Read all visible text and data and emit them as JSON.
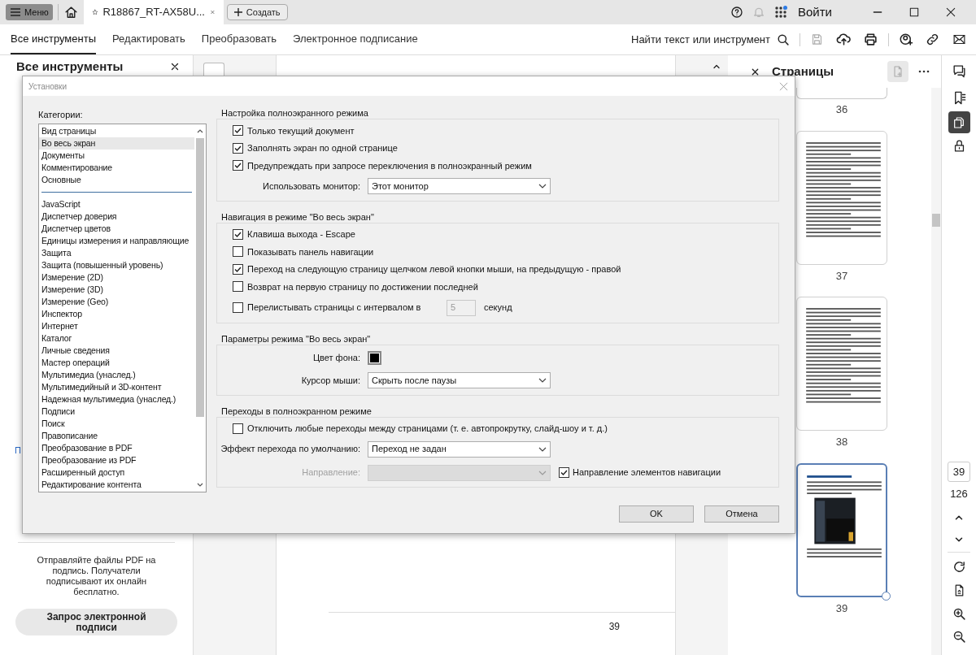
{
  "tabbar": {
    "menu": "Меню",
    "tab_title": "R18867_RT-AX58U...",
    "create": "Создать",
    "sign_in": "Войти"
  },
  "toolbar": {
    "tabs": [
      {
        "label": "Все инструменты",
        "selected": true
      },
      {
        "label": "Редактировать",
        "selected": false
      },
      {
        "label": "Преобразовать",
        "selected": false
      },
      {
        "label": "Электронное подписание",
        "selected": false
      }
    ],
    "search": "Найти текст или инструмент"
  },
  "left_panel": {
    "title": "Все инструменты",
    "cut_link": "П",
    "promo": "Отправляйте файлы PDF на подпись. Получатели подписывают их онлайн бесплатно.",
    "button": "Запрос электронной подписи"
  },
  "document": {
    "page_number": "39"
  },
  "pages_panel": {
    "title": "Страницы",
    "thumbnails": [
      {
        "label": "36",
        "selected": false
      },
      {
        "label": "37",
        "selected": false
      },
      {
        "label": "38",
        "selected": false
      },
      {
        "label": "39",
        "selected": true
      }
    ]
  },
  "page_nav": {
    "current": "39",
    "total": "126"
  },
  "dialog": {
    "title": "Установки",
    "categories_label": "Категории:",
    "categories": [
      {
        "kind": "item",
        "label": "Вид страницы",
        "selected": false
      },
      {
        "kind": "item",
        "label": "Во весь экран",
        "selected": true
      },
      {
        "kind": "item",
        "label": "Документы",
        "selected": false
      },
      {
        "kind": "item",
        "label": "Комментирование",
        "selected": false
      },
      {
        "kind": "item",
        "label": "Основные",
        "selected": false
      },
      {
        "kind": "separator"
      },
      {
        "kind": "item",
        "label": "JavaScript",
        "selected": false
      },
      {
        "kind": "item",
        "label": "Диспетчер доверия",
        "selected": false
      },
      {
        "kind": "item",
        "label": "Диспетчер цветов",
        "selected": false
      },
      {
        "kind": "item",
        "label": "Единицы измерения и направляющие",
        "selected": false
      },
      {
        "kind": "item",
        "label": "Защита",
        "selected": false
      },
      {
        "kind": "item",
        "label": "Защита (повышенный уровень)",
        "selected": false
      },
      {
        "kind": "item",
        "label": "Измерение (2D)",
        "selected": false
      },
      {
        "kind": "item",
        "label": "Измерение (3D)",
        "selected": false
      },
      {
        "kind": "item",
        "label": "Измерение (Geo)",
        "selected": false
      },
      {
        "kind": "item",
        "label": "Инспектор",
        "selected": false
      },
      {
        "kind": "item",
        "label": "Интернет",
        "selected": false
      },
      {
        "kind": "item",
        "label": "Каталог",
        "selected": false
      },
      {
        "kind": "item",
        "label": "Личные сведения",
        "selected": false
      },
      {
        "kind": "item",
        "label": "Мастер операций",
        "selected": false
      },
      {
        "kind": "item",
        "label": "Мультимедиа (унаслед.)",
        "selected": false
      },
      {
        "kind": "item",
        "label": "Мультимедийный и 3D-контент",
        "selected": false
      },
      {
        "kind": "item",
        "label": "Надежная мультимедиа (унаслед.)",
        "selected": false
      },
      {
        "kind": "item",
        "label": "Подписи",
        "selected": false
      },
      {
        "kind": "item",
        "label": "Поиск",
        "selected": false
      },
      {
        "kind": "item",
        "label": "Правописание",
        "selected": false
      },
      {
        "kind": "item",
        "label": "Преобразование в PDF",
        "selected": false
      },
      {
        "kind": "item",
        "label": "Преобразование из PDF",
        "selected": false
      },
      {
        "kind": "item",
        "label": "Расширенный доступ",
        "selected": false
      },
      {
        "kind": "item",
        "label": "Редактирование контента",
        "selected": false
      }
    ],
    "sections": [
      {
        "title": "Настройка полноэкранного режима",
        "rows": [
          {
            "kind": "checkbox",
            "label": "Только текущий документ",
            "checked": true
          },
          {
            "kind": "checkbox",
            "label": "Заполнять экран по одной странице",
            "checked": true
          },
          {
            "kind": "checkbox",
            "label": "Предупреждать при запросе переключения в полноэкранный режим",
            "checked": true
          },
          {
            "kind": "select",
            "label": "Использовать монитор:",
            "value": "Этот монитор",
            "disabled": false
          }
        ]
      },
      {
        "title": "Навигация в режиме \"Во весь экран\"",
        "rows": [
          {
            "kind": "checkbox",
            "label": "Клавиша выхода - Escape",
            "checked": true
          },
          {
            "kind": "checkbox",
            "label": "Показывать панель навигации",
            "checked": false
          },
          {
            "kind": "checkbox",
            "label": "Переход на следующую страницу щелчком левой кнопки мыши, на предыдущую - правой",
            "checked": true
          },
          {
            "kind": "checkbox",
            "label": "Возврат на первую страницу по достижении последней",
            "checked": false
          },
          {
            "kind": "interval",
            "label": "Перелистывать страницы с интервалом в",
            "checked": false,
            "value": "5",
            "unit": "секунд"
          }
        ]
      },
      {
        "title": "Параметры режима \"Во весь экран\"",
        "rows": [
          {
            "kind": "color",
            "label": "Цвет фона:",
            "color": "#000000"
          },
          {
            "kind": "select",
            "label": "Курсор мыши:",
            "value": "Скрыть после паузы",
            "disabled": false
          }
        ]
      },
      {
        "title": "Переходы в полноэкранном режиме",
        "rows": [
          {
            "kind": "checkbox",
            "label": "Отключить любые переходы между страницами (т. е. автопрокрутку, слайд-шоу и т. д.)",
            "checked": false
          },
          {
            "kind": "select",
            "label": "Эффект перехода по умолчанию:",
            "value": "Переход не задан",
            "disabled": false
          },
          {
            "kind": "select_check",
            "label": "Направление:",
            "disabled": true,
            "check_label": "Направление элементов навигации",
            "checked": true
          }
        ]
      }
    ],
    "buttons": [
      "OK",
      "Отмена"
    ]
  }
}
